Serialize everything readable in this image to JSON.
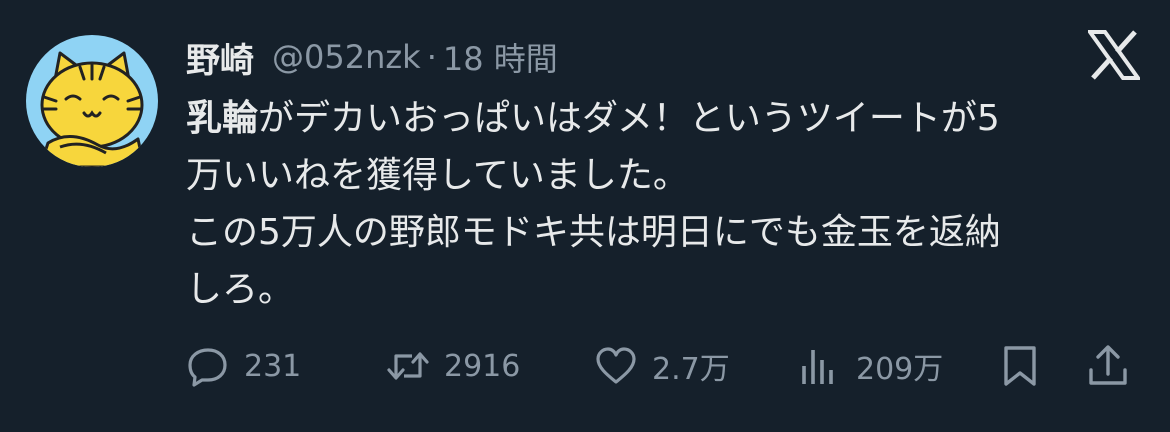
{
  "tweet": {
    "author_name": "野崎",
    "handle": "@052nzk",
    "separator": "·",
    "time": "18 時間",
    "text_bold": "乳輪",
    "text_line1_rest": "がデカいおっぱいはダメ！というツイートが5",
    "text_line2": "万いいねを獲得していました。",
    "text_line3": "この5万人の野郎モドキ共は明日にでも金玉を返納",
    "text_line4": "しろ。"
  },
  "actions": {
    "replies": "231",
    "retweets": "2916",
    "likes": "2.7万",
    "views": "209万"
  },
  "icons": {
    "avatar": "tiger-cat-avatar",
    "brand": "x-logo-icon",
    "reply": "reply-icon",
    "retweet": "retweet-icon",
    "like": "heart-icon",
    "views": "views-icon",
    "bookmark": "bookmark-icon",
    "share": "share-icon"
  },
  "colors": {
    "background": "#15202b",
    "text": "#e7e9ea",
    "secondary": "#8b98a5",
    "avatar_bg": "#8fd3f4",
    "avatar_cat": "#f7d63c"
  }
}
